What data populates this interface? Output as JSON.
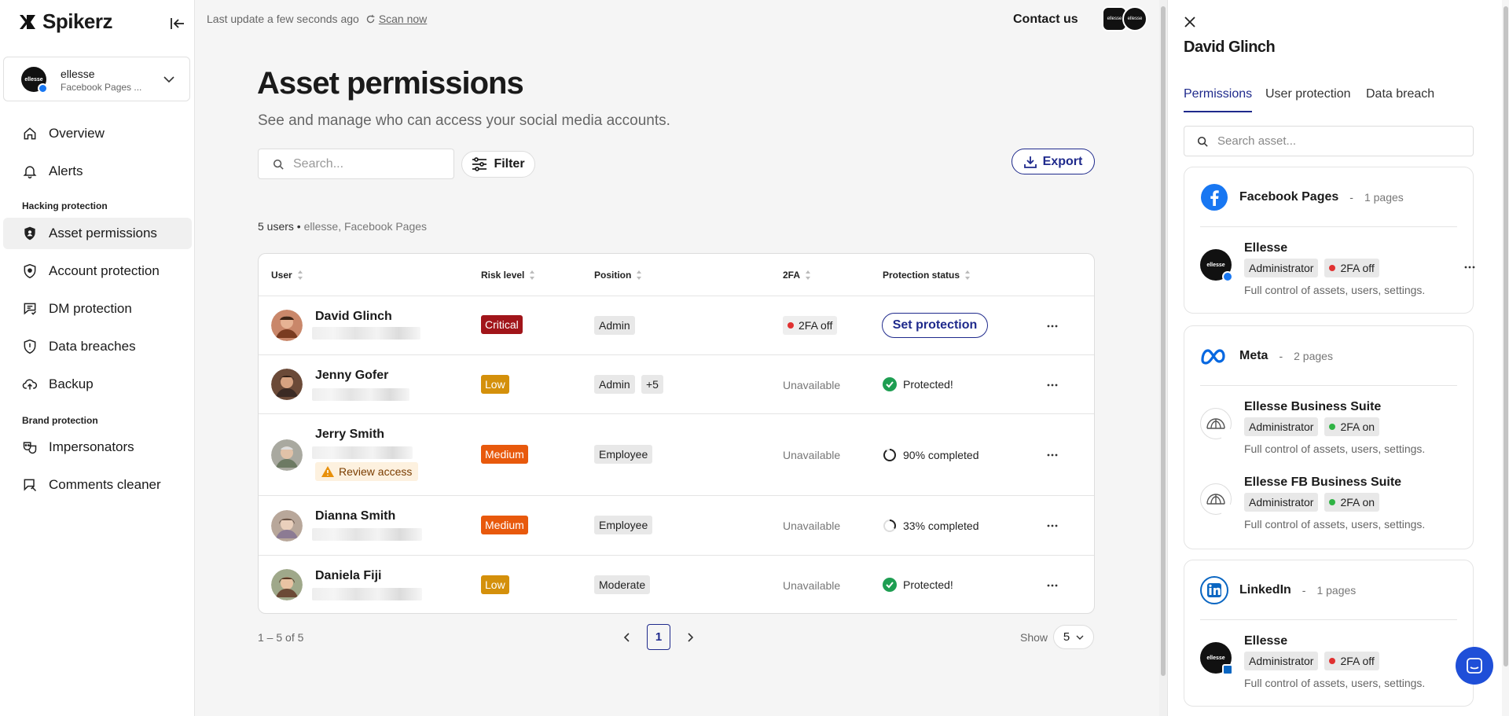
{
  "brand": {
    "name": "Spikerz"
  },
  "account": {
    "name": "ellesse",
    "sub": "Facebook Pages ...",
    "avatar_text": "ellesse"
  },
  "sidebar": {
    "items": [
      {
        "label": "Overview"
      },
      {
        "label": "Alerts"
      },
      {
        "label": "Asset permissions"
      },
      {
        "label": "Account protection"
      },
      {
        "label": "DM protection"
      },
      {
        "label": "Data breaches"
      },
      {
        "label": "Backup"
      },
      {
        "label": "Impersonators"
      },
      {
        "label": "Comments cleaner"
      }
    ],
    "sections": [
      "Hacking protection",
      "Brand protection"
    ]
  },
  "topbar": {
    "last_update": "Last update a few seconds ago",
    "scan": "Scan now",
    "contact": "Contact us"
  },
  "page": {
    "title": "Asset permissions",
    "subtitle": "See and manage who can access your social media accounts.",
    "search_placeholder": "Search...",
    "filter": "Filter",
    "export": "Export",
    "users_count": "5 users",
    "users_context": "ellesse, Facebook Pages"
  },
  "table": {
    "headers": [
      "User",
      "Risk level",
      "Position",
      "2FA",
      "Protection status"
    ],
    "rows": [
      {
        "name": "David Glinch",
        "risk": "Critical",
        "position": "Admin",
        "twofa": "2FA off",
        "status": "Set protection"
      },
      {
        "name": "Jenny Gofer",
        "risk": "Low",
        "position": "Admin",
        "position_extra": "+5",
        "twofa": "Unavailable",
        "status": "Protected!"
      },
      {
        "name": "Jerry Smith",
        "risk": "Medium",
        "position": "Employee",
        "twofa": "Unavailable",
        "status": "90% completed",
        "warning": "Review access"
      },
      {
        "name": "Dianna Smith",
        "risk": "Medium",
        "position": "Employee",
        "twofa": "Unavailable",
        "status": "33% completed"
      },
      {
        "name": "Daniela Fiji",
        "risk": "Low",
        "position": "Moderate",
        "twofa": "Unavailable",
        "status": "Protected!"
      }
    ]
  },
  "pagination": {
    "range": "1 – 5 of 5",
    "current": "1",
    "show_label": "Show",
    "show_value": "5"
  },
  "panel": {
    "title": "David Glinch",
    "tabs": [
      "Permissions",
      "User protection",
      "Data breach"
    ],
    "search_placeholder": "Search asset...",
    "cards": [
      {
        "network": "Facebook Pages",
        "sep": "-",
        "count": "1 pages",
        "assets": [
          {
            "name": "Ellesse",
            "role": "Administrator",
            "twofa": "2FA off",
            "desc": "Full control of assets, users, settings."
          }
        ]
      },
      {
        "network": "Meta",
        "sep": "-",
        "count": "2 pages",
        "assets": [
          {
            "name": "Ellesse Business Suite",
            "role": "Administrator",
            "twofa": "2FA on",
            "desc": "Full control of assets, users, settings."
          },
          {
            "name": "Ellesse FB Business Suite",
            "role": "Administrator",
            "twofa": "2FA on",
            "desc": "Full control of assets, users, settings."
          }
        ]
      },
      {
        "network": "LinkedIn",
        "sep": "-",
        "count": "1 pages",
        "assets": [
          {
            "name": "Ellesse",
            "role": "Administrator",
            "twofa": "2FA off",
            "desc": "Full control of assets, users, settings."
          }
        ]
      }
    ]
  },
  "colors": {
    "accent": "#1f2a8c",
    "critical": "#a1151a",
    "low": "#d4900b",
    "medium": "#e8590c",
    "protected": "#1e9e52",
    "off": "#e03131",
    "on": "#2fb344"
  }
}
